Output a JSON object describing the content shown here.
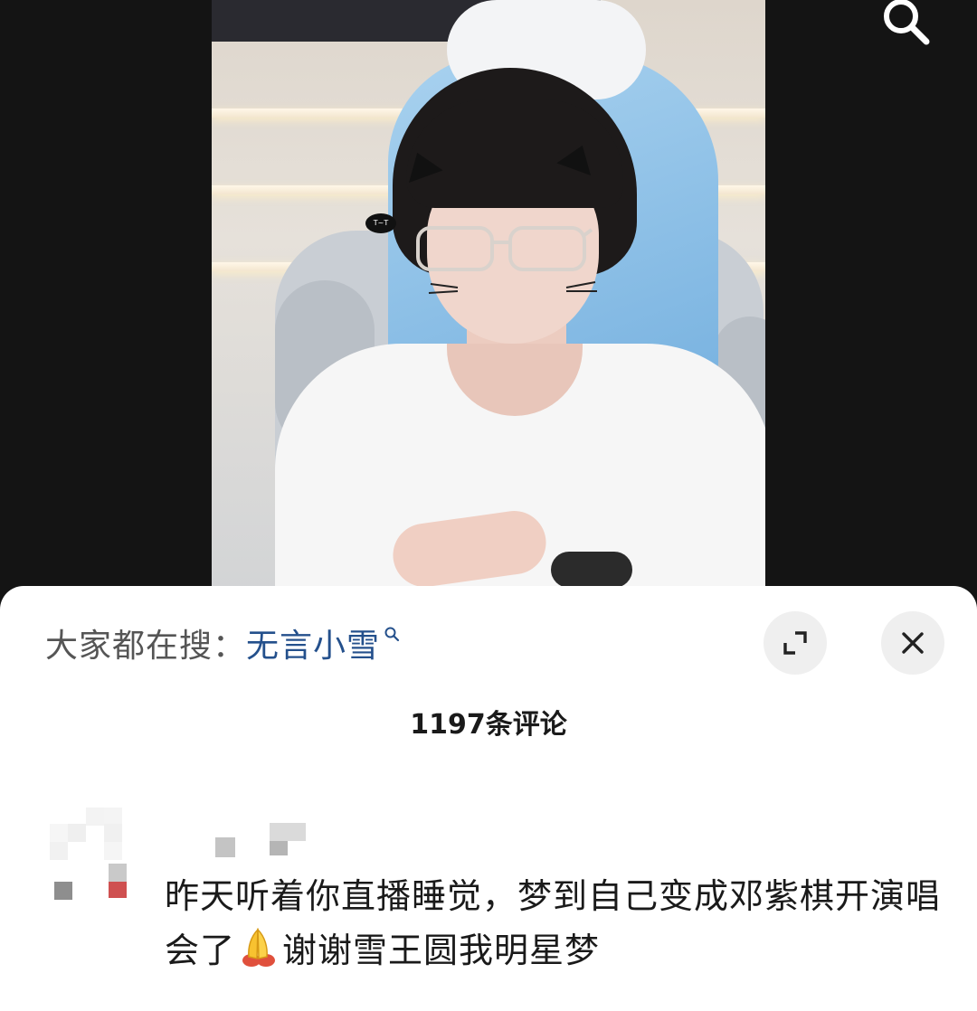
{
  "top_bar": {
    "search_icon": "search-icon"
  },
  "photo": {
    "sticker_text": "T~T"
  },
  "sheet": {
    "trending_label": "大家都在搜：",
    "trending_keyword": "无言小雪",
    "trending_icon": "search-icon",
    "expand_icon": "expand-icon",
    "close_icon": "close-icon",
    "comment_count": "1197条评论"
  },
  "comment": {
    "text_part1": "昨天听着你直播睡觉，梦到自己变成邓紫棋开演唱会了",
    "emoji": "folded-hands-emoji",
    "text_part2": "谢谢雪王圆我明星梦"
  },
  "colors": {
    "trending_keyword": "#24508c",
    "sheet_background": "#ffffff",
    "page_background": "#141414"
  }
}
